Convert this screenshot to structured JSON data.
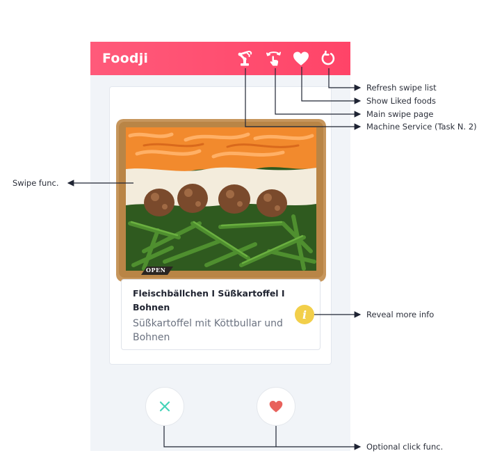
{
  "app": {
    "title": "Foodji",
    "brand_gradient": [
      "#ff5a7a",
      "#ff4468"
    ],
    "nav_icons": [
      {
        "name": "robot-arm-icon"
      },
      {
        "name": "swipe-hand-icon"
      },
      {
        "name": "heart-icon"
      },
      {
        "name": "refresh-icon"
      }
    ]
  },
  "card": {
    "food_name": "Fleischbällchen I Süßkartoffel I Bohnen",
    "food_description": "Süßkartoffel mit Köttbullar und Bohnen",
    "package_tag": "OPEN",
    "info_icon": "i",
    "info_color": "#f2cf4a"
  },
  "actions": {
    "dislike_icon": "close-icon",
    "dislike_color": "#45d3b8",
    "like_icon": "heart-icon",
    "like_color": "#e8625c"
  },
  "annotations": {
    "refresh": "Refresh swipe list",
    "liked": "Show Liked foods",
    "main_swipe": "Main swipe page",
    "machine_service": "Machine Service (Task N. 2)",
    "swipe_func": "Swipe func.",
    "reveal_info": "Reveal more info",
    "optional_click": "Optional click func."
  }
}
